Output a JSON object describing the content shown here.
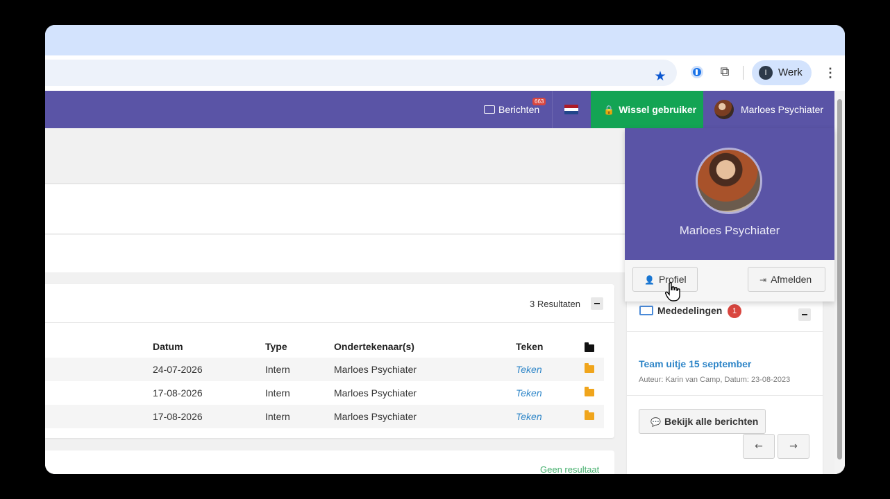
{
  "browser": {
    "profile_initial": "I",
    "profile_name": "Werk",
    "icons": [
      "star-icon",
      "password-manager-icon",
      "extensions-icon",
      "kebab-menu-icon"
    ]
  },
  "topnav": {
    "berichten_label": "Berichten",
    "berichten_count": "663",
    "flag": [
      "#ae1c28",
      "#ffffff",
      "#21468b"
    ],
    "wissel_label": "Wissel gebruiker",
    "user_name": "Marloes Psychiater",
    "colors": {
      "nav_bg": "#5a54a6",
      "wissel_bg": "#13a454"
    }
  },
  "table_card": {
    "results_label": "3 Resultaten",
    "columns": [
      "Datum",
      "Type",
      "Ondertekenaar(s)",
      "Teken"
    ],
    "rows": [
      {
        "datum": "24-07-2026",
        "type": "Intern",
        "signer": "Marloes Psychiater",
        "teken": "Teken"
      },
      {
        "datum": "17-08-2026",
        "type": "Intern",
        "signer": "Marloes Psychiater",
        "teken": "Teken"
      },
      {
        "datum": "17-08-2026",
        "type": "Intern",
        "signer": "Marloes Psychiater",
        "teken": "Teken"
      }
    ]
  },
  "bottom_card": {
    "empty_label": "Geen resultaat"
  },
  "mededelingen": {
    "title": "Mededelingen",
    "count": "1",
    "item_title": "Team uitje 15 september",
    "item_meta": "Auteur: Karin van Camp, Datum: 23-08-2023",
    "all_button": "Bekijk alle berichten"
  },
  "user_dropdown": {
    "name": "Marloes Psychiater",
    "profile_button": "Profiel",
    "logout_button": "Afmelden"
  }
}
